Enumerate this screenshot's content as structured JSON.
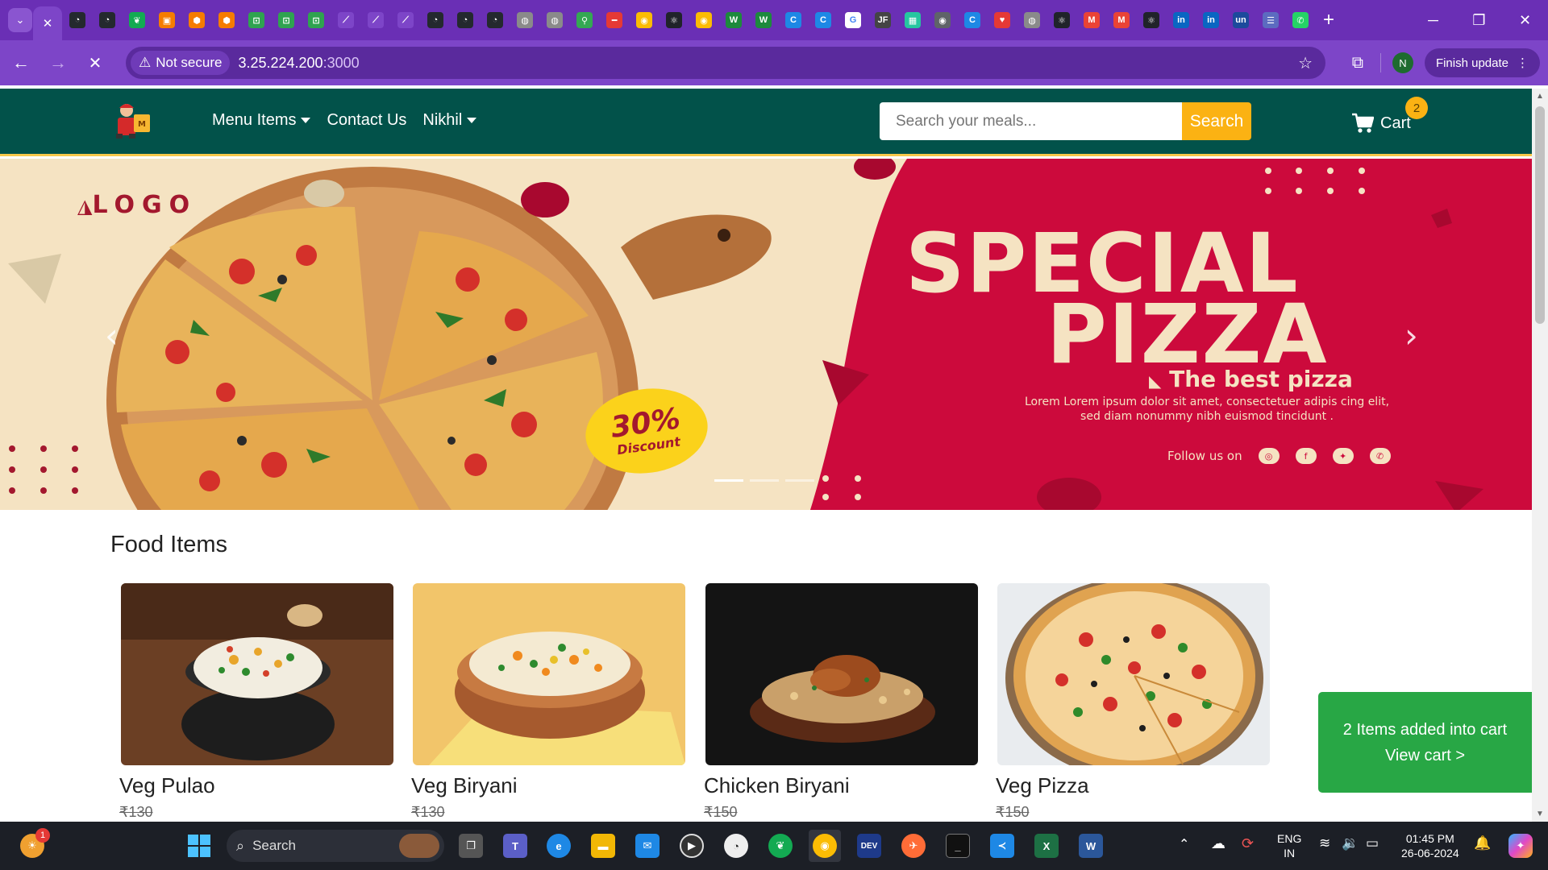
{
  "browser": {
    "tab_active_close": "✕",
    "tab_icons": [
      {
        "name": "github-icon",
        "bg": "#24292e",
        "glyph": "◔"
      },
      {
        "name": "github-icon",
        "bg": "#24292e",
        "glyph": "◔"
      },
      {
        "name": "mongodb-icon",
        "bg": "#13aa52",
        "glyph": "❦"
      },
      {
        "name": "firebase-icon",
        "bg": "#f57c00",
        "glyph": "▣"
      },
      {
        "name": "box-icon",
        "bg": "#f57c00",
        "glyph": "⬢"
      },
      {
        "name": "box-icon",
        "bg": "#f57c00",
        "glyph": "⬢"
      },
      {
        "name": "shopify-icon",
        "bg": "#2fa350",
        "glyph": "⊡"
      },
      {
        "name": "shopify-icon",
        "bg": "#2fa350",
        "glyph": "⊡"
      },
      {
        "name": "shopify-icon",
        "bg": "#2fa350",
        "glyph": "⊡"
      },
      {
        "name": "link-icon",
        "bg": "#7d45c8",
        "glyph": "⟋"
      },
      {
        "name": "link-icon",
        "bg": "#7d45c8",
        "glyph": "⟋"
      },
      {
        "name": "link-icon",
        "bg": "#7d45c8",
        "glyph": "⟋"
      },
      {
        "name": "github-icon",
        "bg": "#24292e",
        "glyph": "◔"
      },
      {
        "name": "github-icon",
        "bg": "#24292e",
        "glyph": "◔"
      },
      {
        "name": "github-icon",
        "bg": "#24292e",
        "glyph": "◔"
      },
      {
        "name": "globe-icon",
        "bg": "#8a8a8a",
        "glyph": "◍"
      },
      {
        "name": "globe-icon",
        "bg": "#8a8a8a",
        "glyph": "◍"
      },
      {
        "name": "maps-icon",
        "bg": "#34a853",
        "glyph": "⚲"
      },
      {
        "name": "minus-icon",
        "bg": "#e53935",
        "glyph": "━"
      },
      {
        "name": "chrome-icon",
        "bg": "#fbbc04",
        "glyph": "◉"
      },
      {
        "name": "react-icon",
        "bg": "#20232a",
        "glyph": "⚛"
      },
      {
        "name": "chrome-icon",
        "bg": "#fbbc04",
        "glyph": "◉"
      },
      {
        "name": "w-icon",
        "bg": "#1d8a3c",
        "glyph": "W"
      },
      {
        "name": "w-icon",
        "bg": "#1d8a3c",
        "glyph": "W"
      },
      {
        "name": "c-icon",
        "bg": "#1e88e5",
        "glyph": "C"
      },
      {
        "name": "c-icon",
        "bg": "#1e88e5",
        "glyph": "C"
      },
      {
        "name": "google-icon",
        "bg": "#ffffff",
        "glyph": "G"
      },
      {
        "name": "jf-icon",
        "bg": "#444444",
        "glyph": "JF"
      },
      {
        "name": "app-icon",
        "bg": "#26c6a0",
        "glyph": "▦"
      },
      {
        "name": "chrome-icon",
        "bg": "#5f6368",
        "glyph": "◉"
      },
      {
        "name": "c-icon",
        "bg": "#1e88e5",
        "glyph": "C"
      },
      {
        "name": "heart-icon",
        "bg": "#e53935",
        "glyph": "♥"
      },
      {
        "name": "globe-icon",
        "bg": "#8a8a8a",
        "glyph": "◍"
      },
      {
        "name": "react-icon",
        "bg": "#20232a",
        "glyph": "⚛"
      },
      {
        "name": "gmail-icon",
        "bg": "#ea4335",
        "glyph": "M"
      },
      {
        "name": "gmail-icon",
        "bg": "#ea4335",
        "glyph": "M"
      },
      {
        "name": "react-icon",
        "bg": "#20232a",
        "glyph": "⚛"
      },
      {
        "name": "linkedin-icon",
        "bg": "#0a66c2",
        "glyph": "in"
      },
      {
        "name": "linkedin-icon",
        "bg": "#0a66c2",
        "glyph": "in"
      },
      {
        "name": "unstop-icon",
        "bg": "#1c4a9c",
        "glyph": "un"
      },
      {
        "name": "list-icon",
        "bg": "#5c6bc0",
        "glyph": "☰"
      },
      {
        "name": "whatsapp-icon",
        "bg": "#25d366",
        "glyph": "✆"
      }
    ],
    "new_tab": "+",
    "security_label": "Not secure",
    "url_host": "3.25.224.200",
    "url_port": ":3000",
    "profile_initial": "N",
    "finish_update_label": "Finish update"
  },
  "site": {
    "nav": {
      "menu_items_label": "Menu Items",
      "contact_label": "Contact Us",
      "user_label": "Nikhil"
    },
    "search": {
      "placeholder": "Search your meals...",
      "button_label": "Search"
    },
    "cart": {
      "label": "Cart",
      "count": "2"
    },
    "banner": {
      "logo_text": "LOGO",
      "title_line1": "SPECIAL",
      "title_line2": "PIZZA",
      "subtitle": "The best pizza",
      "description": "Lorem Lorem ipsum dolor sit amet, consectetuer adipis cing elit, sed diam nonummy nibh euismod tincidunt .",
      "follow_label": "Follow us on",
      "discount_percent": "30%",
      "discount_label": "Discount",
      "prev_label": "‹",
      "next_label": "›",
      "slide_count": 3,
      "active_slide": 1
    },
    "section_title": "Food Items",
    "foods": [
      {
        "name": "Veg Pulao",
        "price": "₹130"
      },
      {
        "name": "Veg Biryani",
        "price": "₹130"
      },
      {
        "name": "Chicken Biryani",
        "price": "₹150"
      },
      {
        "name": "Veg Pizza",
        "price": "₹150"
      }
    ],
    "toast": {
      "line1": "2 Items added into cart",
      "line2": "View cart >"
    }
  },
  "taskbar": {
    "search_label": "Search",
    "language_line1": "ENG",
    "language_line2": "IN",
    "time": "01:45 PM",
    "date": "26-06-2024",
    "weather_badge": "1"
  },
  "colors": {
    "browser_purple": "#7d45c8",
    "site_nav": "#02524a",
    "accent_yellow": "#fbb213",
    "banner_red": "#cc0a3c",
    "toast_green": "#28a745"
  }
}
